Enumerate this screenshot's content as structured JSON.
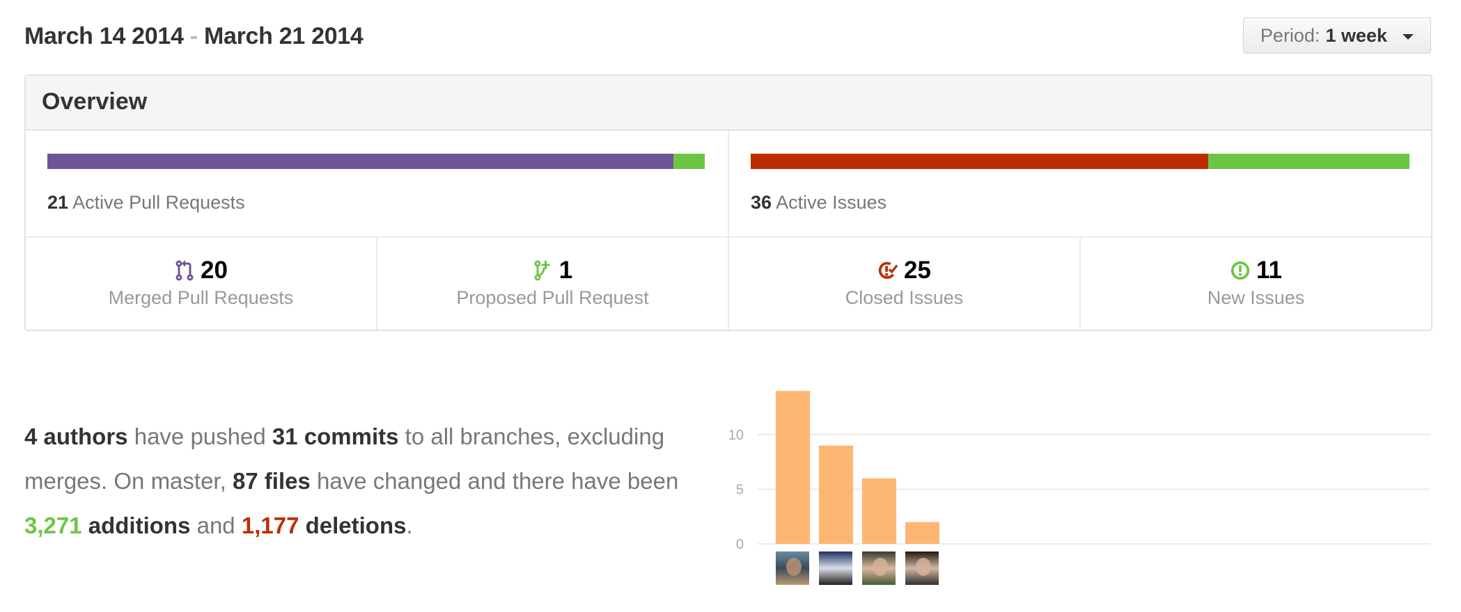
{
  "header": {
    "date_start": "March 14 2014",
    "date_separator": "-",
    "date_end": "March 21 2014",
    "period_label": "Period:",
    "period_value": "1 week"
  },
  "overview": {
    "title": "Overview",
    "pull_requests": {
      "active_count": "21",
      "active_label": "Active Pull Requests",
      "merged_fraction": 0.952,
      "colors": {
        "merged": "#6e5494",
        "proposed": "#6cc644"
      }
    },
    "issues": {
      "active_count": "36",
      "active_label": "Active Issues",
      "closed_fraction": 0.694,
      "colors": {
        "closed": "#bd2c00",
        "new": "#6cc644"
      }
    },
    "stats": [
      {
        "icon": "git-merge-icon",
        "color": "#6e5494",
        "value": "20",
        "label": "Merged Pull Requests"
      },
      {
        "icon": "git-pull-request-icon",
        "color": "#6cc644",
        "value": "1",
        "label": "Proposed Pull Request"
      },
      {
        "icon": "issue-closed-icon",
        "color": "#bd2c00",
        "value": "25",
        "label": "Closed Issues"
      },
      {
        "icon": "issue-opened-icon",
        "color": "#6cc644",
        "value": "11",
        "label": "New Issues"
      }
    ]
  },
  "commits_summary": {
    "authors": "4 authors",
    "t1": " have pushed ",
    "commits": "31 commits",
    "t2": " to all branches, excluding merges. On master, ",
    "files": "87 files",
    "t3": " have changed and there have been ",
    "additions_num": "3,271",
    "additions_label": " additions",
    "t4": " and ",
    "deletions_num": "1,177",
    "deletions_label": " deletions",
    "t5": "."
  },
  "chart_data": {
    "type": "bar",
    "title": "",
    "xlabel": "",
    "ylabel": "",
    "categories": [
      "author 1",
      "author 2",
      "author 3",
      "author 4"
    ],
    "values": [
      14,
      9,
      6,
      2
    ],
    "yticks": [
      0,
      5,
      10
    ],
    "ylim": [
      0,
      15
    ],
    "grid": true,
    "bar_color": "#fdb26a",
    "avatar_colors": [
      [
        "#6a8aa0",
        "#3a4a5a",
        "#b89a70"
      ],
      [
        "#1e3060",
        "#d8dde8",
        "#202020"
      ],
      [
        "#3a3a2a",
        "#d8b8a0",
        "#4a5a30"
      ],
      [
        "#201810",
        "#d0b8a0",
        "#303030"
      ]
    ]
  }
}
